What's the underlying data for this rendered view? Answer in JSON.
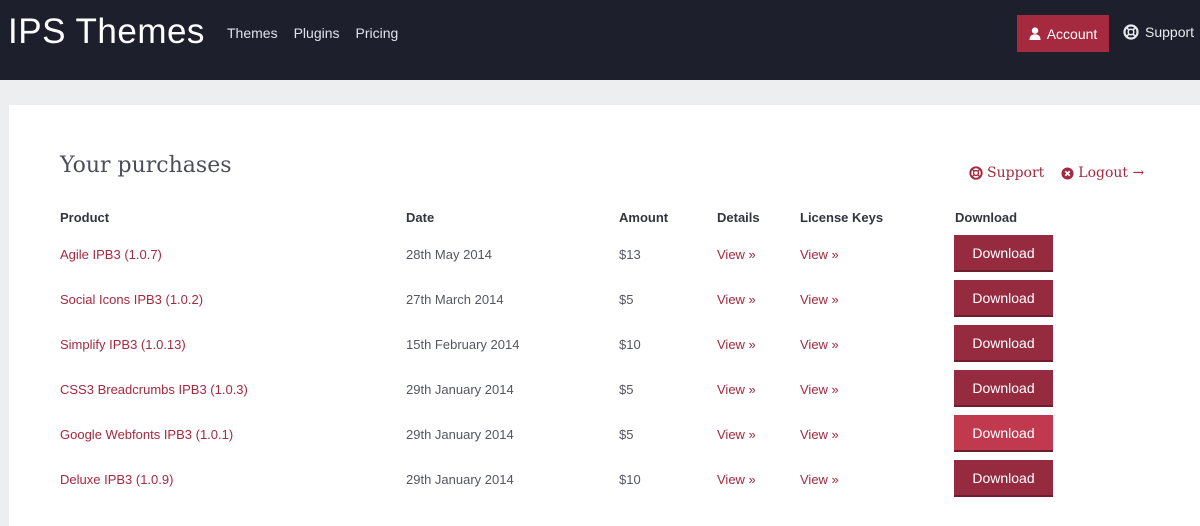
{
  "header": {
    "brand": "IPS Themes",
    "nav": [
      "Themes",
      "Plugins",
      "Pricing"
    ],
    "account_label": "Account",
    "support_label": "Support"
  },
  "page": {
    "title": "Your purchases",
    "support_link": "Support",
    "logout_link": "Logout →"
  },
  "table": {
    "columns": [
      "Product",
      "Date",
      "Amount",
      "Details",
      "License Keys",
      "Download"
    ],
    "rows": [
      {
        "product": "Agile IPB3 (1.0.7)",
        "date": "28th May 2014",
        "amount": "$13",
        "details": "View »",
        "license": "View »",
        "download": "Download"
      },
      {
        "product": "Social Icons IPB3 (1.0.2)",
        "date": "27th March 2014",
        "amount": "$5",
        "details": "View »",
        "license": "View »",
        "download": "Download"
      },
      {
        "product": "Simplify IPB3 (1.0.13)",
        "date": "15th February 2014",
        "amount": "$10",
        "details": "View »",
        "license": "View »",
        "download": "Download"
      },
      {
        "product": "CSS3 Breadcrumbs IPB3 (1.0.3)",
        "date": "29th January 2014",
        "amount": "$5",
        "details": "View »",
        "license": "View »",
        "download": "Download"
      },
      {
        "product": "Google Webfonts IPB3 (1.0.1)",
        "date": "29th January 2014",
        "amount": "$5",
        "details": "View »",
        "license": "View »",
        "download": "Download"
      },
      {
        "product": "Deluxe IPB3 (1.0.9)",
        "date": "29th January 2014",
        "amount": "$10",
        "details": "View »",
        "license": "View »",
        "download": "Download"
      }
    ]
  },
  "colors": {
    "topbar": "#1d202c",
    "accent": "#a5293f",
    "download_button": "#962b40",
    "download_button_hover": "#c0394f"
  },
  "icons": {
    "account": "user-icon",
    "support": "lifebuoy-icon",
    "logout": "close-circle-icon"
  }
}
